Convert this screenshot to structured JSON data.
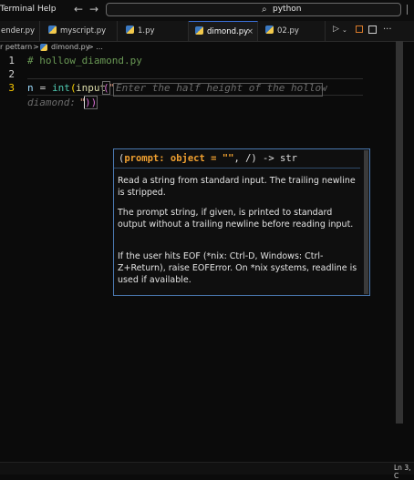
{
  "menu": {
    "terminal": "Terminal",
    "help": "Help"
  },
  "search": {
    "text": "python"
  },
  "tabs": [
    {
      "label": "ender.py"
    },
    {
      "label": "myscript.py"
    },
    {
      "label": "1.py"
    },
    {
      "label": "dimond.py",
      "close": "×"
    },
    {
      "label": "02.py"
    }
  ],
  "breadcrumb": {
    "folder": "r pettarn",
    "sep": ">",
    "file": "dimond.py",
    "more": "> ..."
  },
  "lines": {
    "n1": "1",
    "n2": "2",
    "n3": "3"
  },
  "code": {
    "comment": "# hollow_diamond.py",
    "l3_var": "n",
    "l3_eq": " = ",
    "l3_int": "int",
    "l3_p1": "(",
    "l3_input": "input",
    "l3_p2": "(",
    "l3_q": "\"",
    "ghost1": "Enter the half height of the hollow",
    "ghost2": "diamond: ",
    "l3_q2": "\"",
    "l3_close": "))"
  },
  "tooltip": {
    "sig_open": "(",
    "sig_param": "prompt: object = \"\"",
    "sig_rest": ", /) -> str",
    "doc1": "Read a string from standard input. The trailing newline is stripped.",
    "doc2": "The prompt string, if given, is printed to standard output without a trailing newline before reading input.",
    "doc3": "If the user hits EOF (*nix: Ctrl-D, Windows: Ctrl-Z+Return), raise EOFError. On *nix systems, readline is used if available."
  },
  "status": {
    "pos": "Ln 3, C"
  }
}
